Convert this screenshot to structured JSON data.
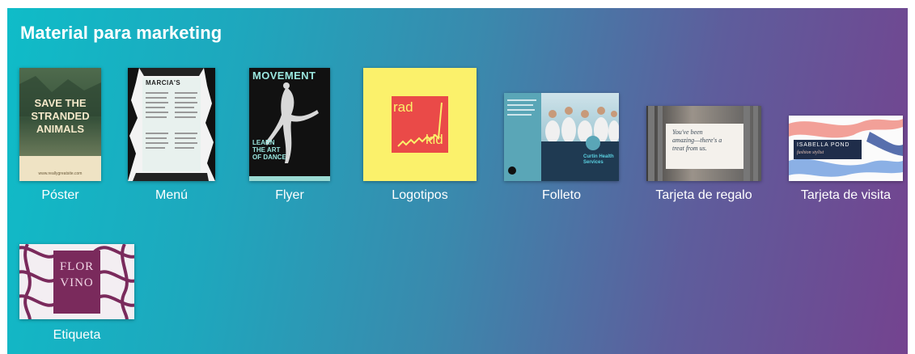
{
  "section": {
    "title": "Material para marketing"
  },
  "cards": [
    {
      "label": "Póster",
      "thumb": {
        "top": "SAVE THE",
        "mid": "STRANDED",
        "bot": "ANIMALS",
        "footer": "www.reallygreatsite.com"
      }
    },
    {
      "label": "Menú",
      "thumb": {
        "header": "MARCIA'S"
      }
    },
    {
      "label": "Flyer",
      "thumb": {
        "header": "MOVEMENT",
        "line1": "LEARN",
        "line2": "THE ART",
        "line3": "OF DANCE"
      }
    },
    {
      "label": "Logotipos",
      "thumb": {
        "word1": "rad",
        "word2": "kid"
      }
    },
    {
      "label": "Folleto",
      "thumb": {
        "name": "Curtin Health Services"
      }
    },
    {
      "label": "Tarjeta de regalo",
      "thumb": {
        "line1": "You've been",
        "line2": "amazing—there's a",
        "line3": "treat from us."
      }
    },
    {
      "label": "Tarjeta de visita",
      "thumb": {
        "name": "ISABELLA POND",
        "role": "fashion stylist"
      }
    },
    {
      "label": "Etiqueta",
      "thumb": {
        "line1": "FLOR",
        "line2": "VINO"
      }
    }
  ]
}
